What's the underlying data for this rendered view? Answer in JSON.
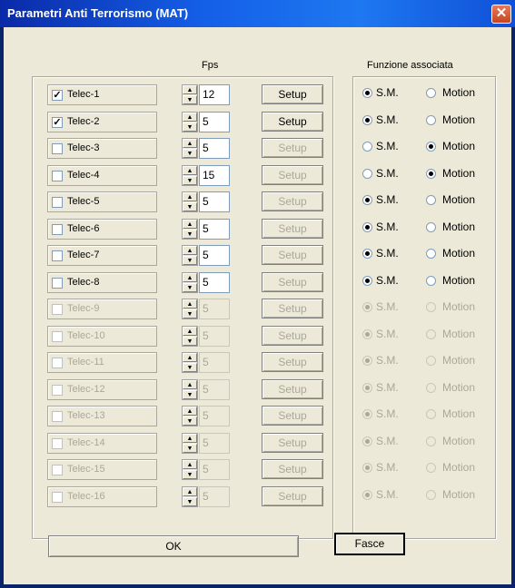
{
  "window": {
    "title": "Parametri Anti Terrorismo (MAT)",
    "close_label": "✕"
  },
  "headers": {
    "fps": "Fps",
    "function": "Funzione associata"
  },
  "rows": [
    {
      "label": "Telec-1",
      "checked": "✓",
      "fps": "12",
      "setup": "Setup",
      "opt1": "S.M.",
      "opt2": "Motion",
      "sel": 1,
      "enabled": true,
      "setup_enabled": true
    },
    {
      "label": "Telec-2",
      "checked": "✓",
      "fps": "5",
      "setup": "Setup",
      "opt1": "S.M.",
      "opt2": "Motion",
      "sel": 1,
      "enabled": true,
      "setup_enabled": true
    },
    {
      "label": "Telec-3",
      "checked": "",
      "fps": "5",
      "setup": "Setup",
      "opt1": "S.M.",
      "opt2": "Motion",
      "sel": 2,
      "enabled": true,
      "setup_enabled": false
    },
    {
      "label": "Telec-4",
      "checked": "",
      "fps": "15",
      "setup": "Setup",
      "opt1": "S.M.",
      "opt2": "Motion",
      "sel": 2,
      "enabled": true,
      "setup_enabled": false
    },
    {
      "label": "Telec-5",
      "checked": "",
      "fps": "5",
      "setup": "Setup",
      "opt1": "S.M.",
      "opt2": "Motion",
      "sel": 1,
      "enabled": true,
      "setup_enabled": false
    },
    {
      "label": "Telec-6",
      "checked": "",
      "fps": "5",
      "setup": "Setup",
      "opt1": "S.M.",
      "opt2": "Motion",
      "sel": 1,
      "enabled": true,
      "setup_enabled": false
    },
    {
      "label": "Telec-7",
      "checked": "",
      "fps": "5",
      "setup": "Setup",
      "opt1": "S.M.",
      "opt2": "Motion",
      "sel": 1,
      "enabled": true,
      "setup_enabled": false
    },
    {
      "label": "Telec-8",
      "checked": "",
      "fps": "5",
      "setup": "Setup",
      "opt1": "S.M.",
      "opt2": "Motion",
      "sel": 1,
      "enabled": true,
      "setup_enabled": false
    },
    {
      "label": "Telec-9",
      "checked": "",
      "fps": "5",
      "setup": "Setup",
      "opt1": "S.M.",
      "opt2": "Motion",
      "sel": 1,
      "enabled": false,
      "setup_enabled": false
    },
    {
      "label": "Telec-10",
      "checked": "",
      "fps": "5",
      "setup": "Setup",
      "opt1": "S.M.",
      "opt2": "Motion",
      "sel": 1,
      "enabled": false,
      "setup_enabled": false
    },
    {
      "label": "Telec-11",
      "checked": "",
      "fps": "5",
      "setup": "Setup",
      "opt1": "S.M.",
      "opt2": "Motion",
      "sel": 1,
      "enabled": false,
      "setup_enabled": false
    },
    {
      "label": "Telec-12",
      "checked": "",
      "fps": "5",
      "setup": "Setup",
      "opt1": "S.M.",
      "opt2": "Motion",
      "sel": 1,
      "enabled": false,
      "setup_enabled": false
    },
    {
      "label": "Telec-13",
      "checked": "",
      "fps": "5",
      "setup": "Setup",
      "opt1": "S.M.",
      "opt2": "Motion",
      "sel": 1,
      "enabled": false,
      "setup_enabled": false
    },
    {
      "label": "Telec-14",
      "checked": "",
      "fps": "5",
      "setup": "Setup",
      "opt1": "S.M.",
      "opt2": "Motion",
      "sel": 1,
      "enabled": false,
      "setup_enabled": false
    },
    {
      "label": "Telec-15",
      "checked": "",
      "fps": "5",
      "setup": "Setup",
      "opt1": "S.M.",
      "opt2": "Motion",
      "sel": 1,
      "enabled": false,
      "setup_enabled": false
    },
    {
      "label": "Telec-16",
      "checked": "",
      "fps": "5",
      "setup": "Setup",
      "opt1": "S.M.",
      "opt2": "Motion",
      "sel": 1,
      "enabled": false,
      "setup_enabled": false
    }
  ],
  "spinner": {
    "up": "▲",
    "down": "▼"
  },
  "buttons": {
    "ok": "OK",
    "fasce": "Fasce"
  }
}
